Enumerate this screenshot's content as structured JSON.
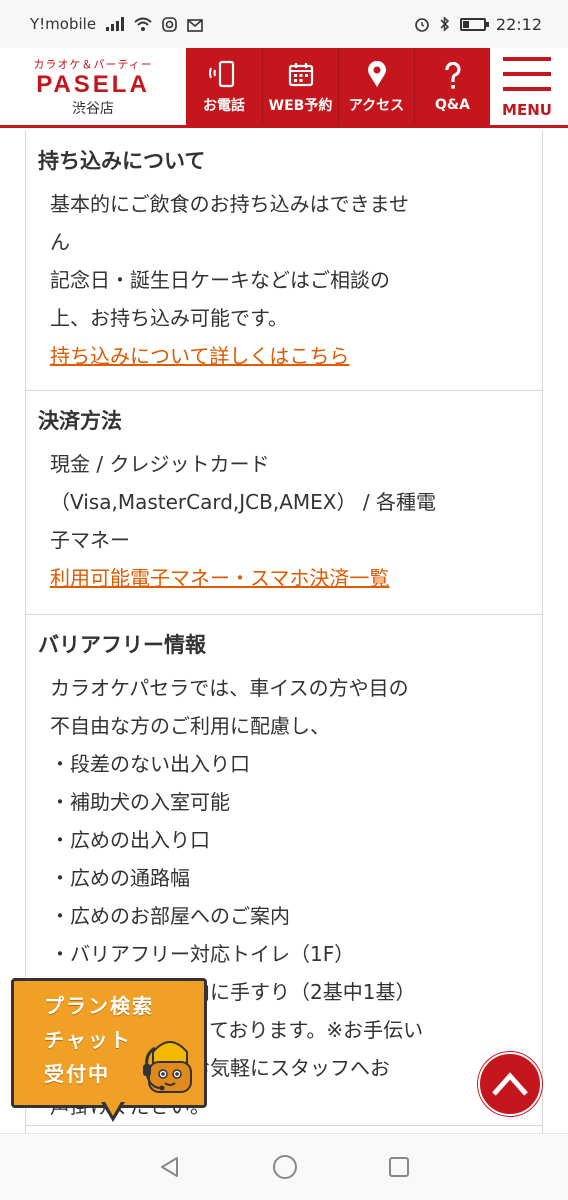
{
  "status_bar": {
    "carrier": "Y!mobile",
    "time": "22:12"
  },
  "header": {
    "logo_tagline": "カラオケ＆パーティー",
    "logo_brand": "PASELA",
    "store_name": "渋谷店",
    "nav": [
      {
        "label": "お電話",
        "icon": "phone-icon"
      },
      {
        "label": "WEB予約",
        "icon": "calendar-icon"
      },
      {
        "label": "アクセス",
        "icon": "map-pin-icon"
      },
      {
        "label": "Q&A",
        "icon": "question-icon"
      }
    ],
    "menu_label": "MENU"
  },
  "sections": {
    "bring_in": {
      "title": "持ち込みについて",
      "lines": [
        "基本的にご飲食のお持ち込みはできませ",
        "ん",
        "記念日・誕生日ケーキなどはご相談の",
        "上、お持ち込み可能です。"
      ],
      "link": "持ち込みについて詳しくはこちら"
    },
    "payment": {
      "title": "決済方法",
      "lines": [
        "現金 / クレジットカード",
        "（Visa,MasterCard,JCB,AMEX） / 各種電",
        "子マネー"
      ],
      "link": "利用可能電子マネー・スマホ決済一覧"
    },
    "barrier_free": {
      "title": "バリアフリー情報",
      "lines": [
        "カラオケパセラでは、車イスの方や目の",
        "不自由な方のご利用に配慮し、",
        "・段差のない出入り口",
        "・補助犬の入室可能",
        "・広めの出入り口",
        "・広めの通路幅",
        "・広めのお部屋へのご案内",
        "・バリアフリー対応トイレ（1F）",
        "・エレベーター内に手すり（2基中1基）",
        "などの対応を行っております。※お手伝い",
        "が必要な際は、お気軽にスタッフへお",
        "声掛けください。"
      ]
    }
  },
  "chat_badge": {
    "lines": [
      "プラン検索",
      "チャット",
      "受付中"
    ]
  },
  "colors": {
    "brand_red": "#c4161c",
    "link_orange": "#e05a00",
    "chat_orange": "#f0a024"
  }
}
